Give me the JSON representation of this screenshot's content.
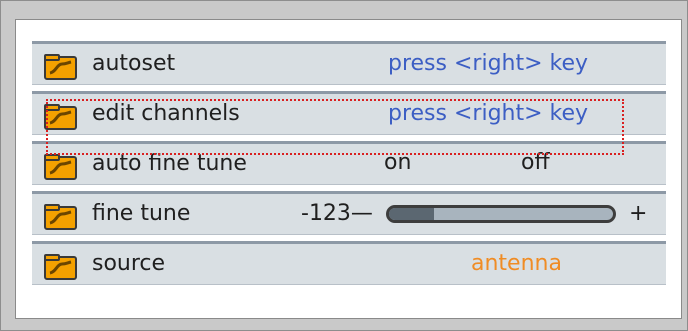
{
  "menu": {
    "items": [
      {
        "label": "autoset",
        "value": "press <right> key",
        "icon": "folder-icon"
      },
      {
        "label": "edit channels",
        "value": "press <right> key",
        "icon": "folder-icon"
      },
      {
        "label": "auto fine tune",
        "options": [
          "on",
          "off"
        ],
        "icon": "folder-icon"
      },
      {
        "label": "fine tune",
        "value": "-123—",
        "plus": "+",
        "level": 0.2,
        "icon": "folder-icon"
      },
      {
        "label": "source",
        "value": "antenna",
        "icon": "folder-icon"
      }
    ]
  },
  "colors": {
    "background": "#c9c9c9",
    "row_background": "#d9dfe3",
    "row_border": "#8d99a6",
    "link_text": "#3c5ec4",
    "accent_orange": "#f08c24",
    "focus_dots": "#d92020",
    "slider_track": "#a8b4be",
    "slider_fill": "#5b6771"
  }
}
